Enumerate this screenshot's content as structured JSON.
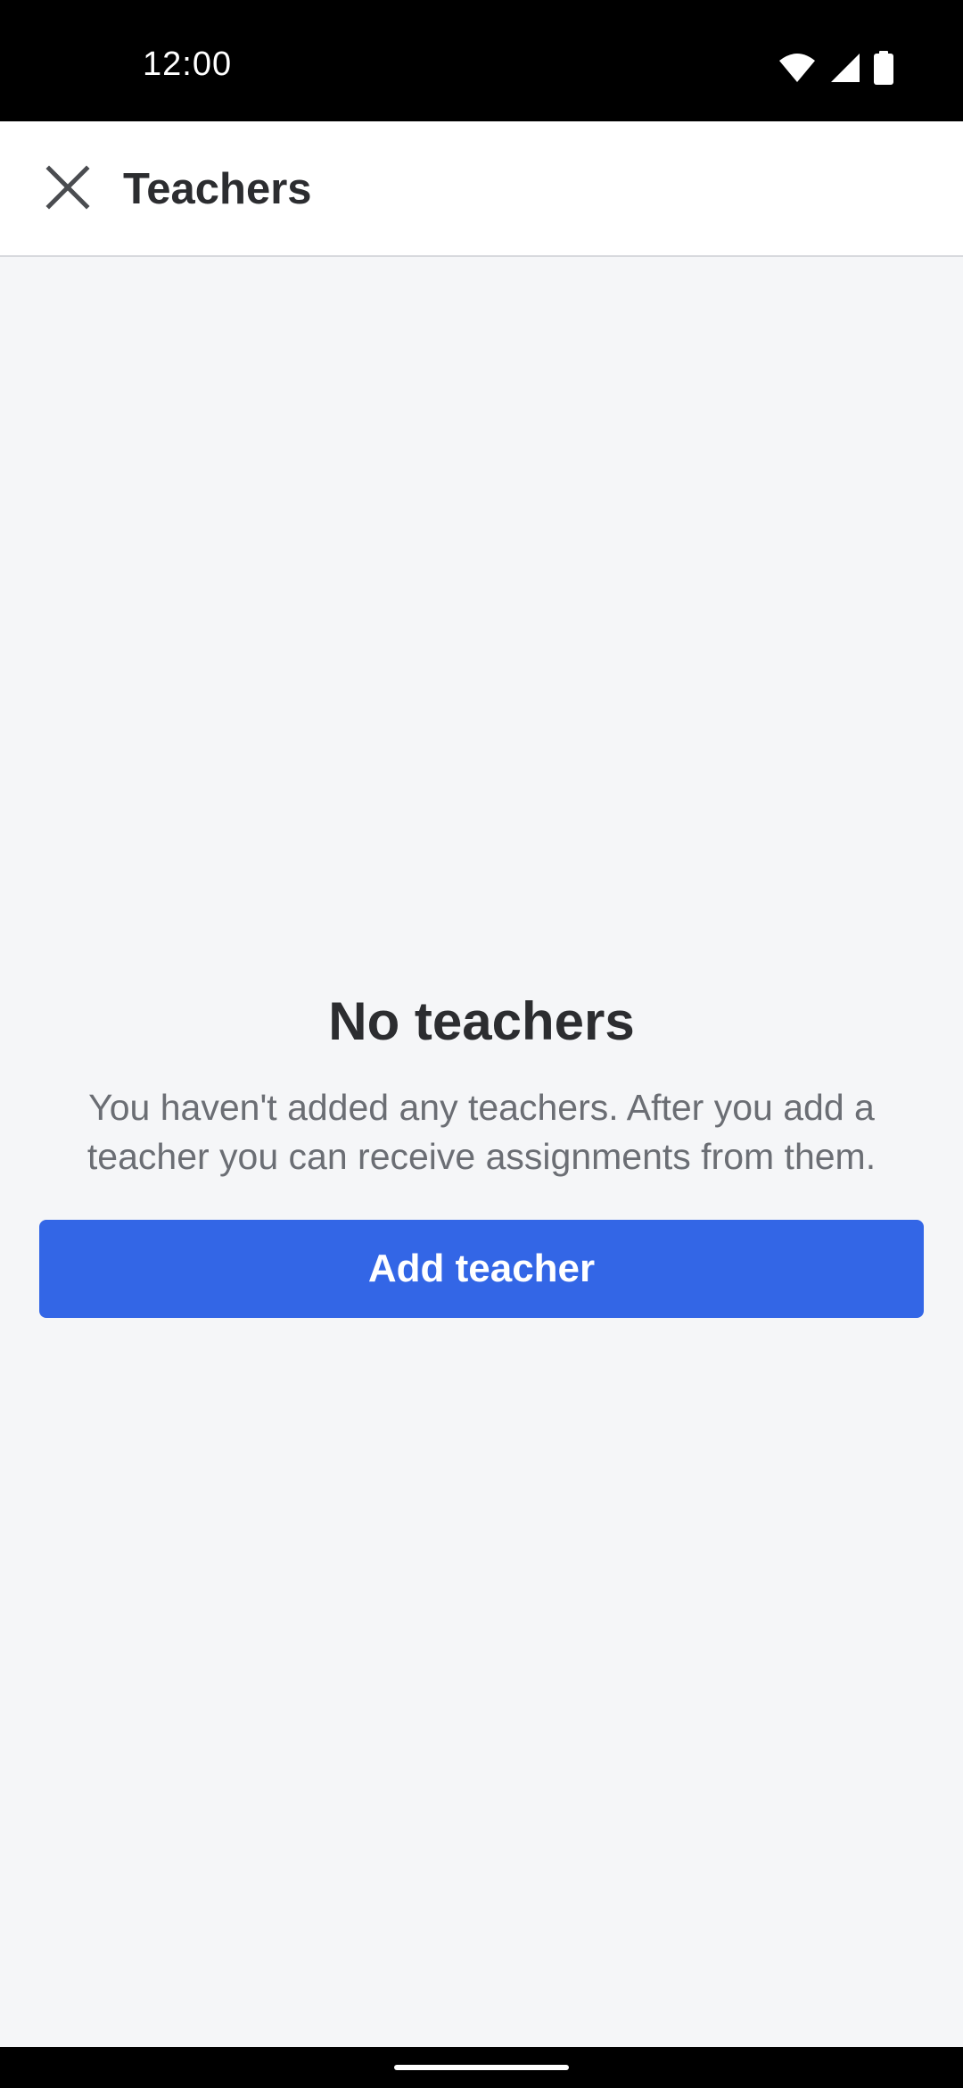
{
  "status_bar": {
    "time": "12:00",
    "icons": [
      "wifi-icon",
      "signal-icon",
      "battery-icon"
    ]
  },
  "app_bar": {
    "close_icon": "close-icon",
    "title": "Teachers"
  },
  "empty_state": {
    "title": "No teachers",
    "message": "You haven't added any teachers. After you add a teacher you can receive assignments from them."
  },
  "actions": {
    "add_teacher_label": "Add teacher"
  },
  "colors": {
    "accent": "#3366e6",
    "background": "#f5f6f8",
    "title_text": "#2c2d30",
    "body_text": "#6b6e74"
  }
}
